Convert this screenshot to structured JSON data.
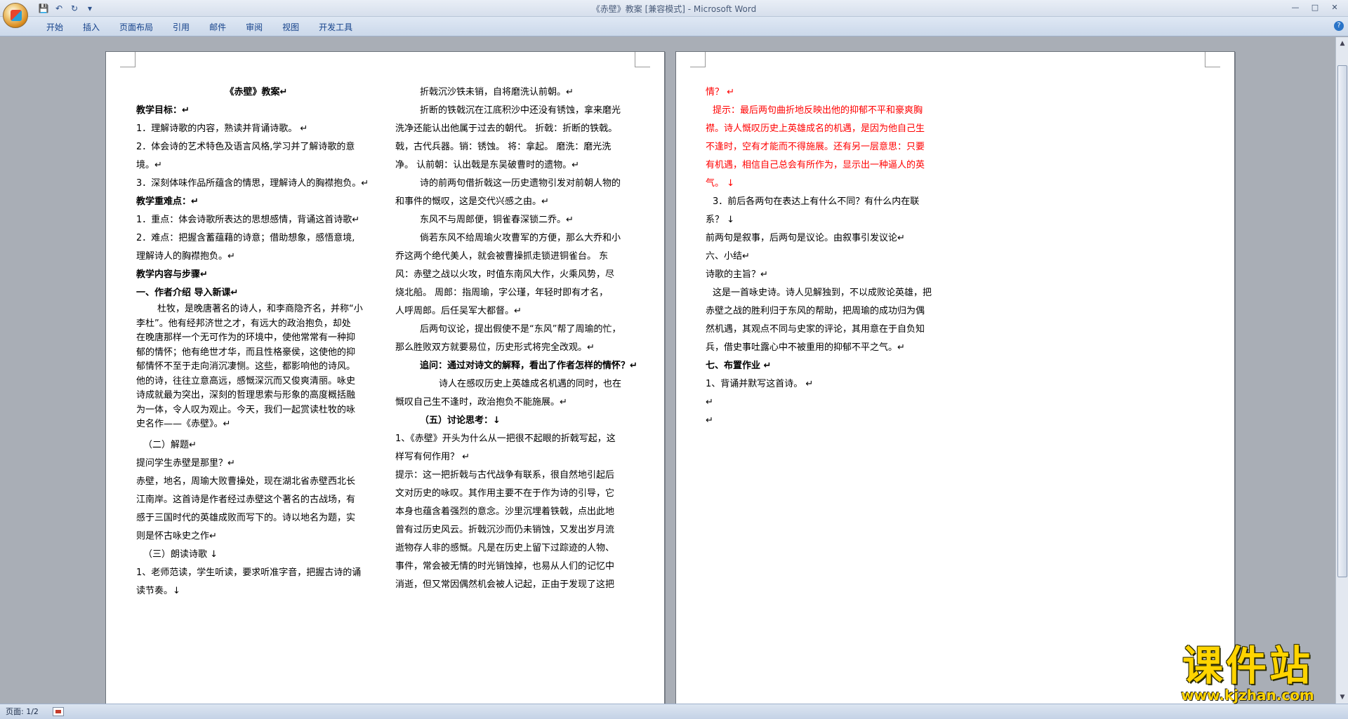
{
  "window": {
    "title": "《赤壁》教案 [兼容模式] - Microsoft Word",
    "qat": {
      "save": "💾",
      "undo": "↶",
      "redo": "↻",
      "more": "▾"
    },
    "controls": {
      "minimize": "—",
      "maximize": "□",
      "close": "✕"
    },
    "help": "?"
  },
  "ribbon": {
    "tabs": [
      "开始",
      "插入",
      "页面布局",
      "引用",
      "邮件",
      "审阅",
      "视图",
      "开发工具"
    ]
  },
  "page1": {
    "col1": [
      "《赤壁》教案↵",
      "教学目标：↵",
      "1．理解诗歌的内容，熟读并背诵诗歌。 ↵",
      "2．体会诗的艺术特色及语言风格,学习并了解诗歌的意",
      "境。↵",
      "3．深刻体味作品所蕴含的情思，理解诗人的胸襟抱负。↵",
      "教学重难点：↵",
      "1．重点：体会诗歌所表达的思想感情，背诵这首诗歌↵",
      "2．难点：把握含蓄蕴藉的诗意；借助想象，感悟意境,",
      "理解诗人的胸襟抱负。↵",
      "教学内容与步骤↵",
      "一、作者介绍 导入新课↵",
      "杜牧，是晚唐著名的诗人，和李商隐齐名，并称“小",
      "李杜”。他有经邦济世之才，有远大的政治抱负，却处",
      "在晚唐那样一个无可作为的环境中，使他常常有一种抑",
      "郁的情怀；他有绝世才华，而且性格豪侯，这使他的抑",
      "郁情怀不至于走向消沉凄恻。这些，都影响他的诗风。",
      "他的诗，往往立意高远，感慨深沉而又俊爽清丽。咏史",
      "诗成就最为突出，深刻的哲理思索与形象的高度概括融",
      "为一体，令人叹为观止。今天，我们一起赏读杜牧的咏",
      "史名作——《赤壁》。↵",
      "（二）解题↵",
      "提问学生赤壁是那里？↵",
      "赤壁，地名，周瑜大败曹操处，现在湖北省赤壁西北长",
      "江南岸。这首诗是作者经过赤壁这个著名的古战场，有",
      "感于三国时代的英雄成败而写下的。诗以地名为题，实",
      "则是怀古咏史之作↵",
      "（三）朗读诗歌 ↓",
      "1、老师范读，学生听读，要求听准字音，把握古诗的诵",
      "读节奏。↓"
    ],
    "col2": [
      "折戟沉沙铁未销，自将磨洗认前朝。↵",
      "折断的铁戟沉在江底积沙中还没有锈蚀，拿来磨光",
      "洗净还能认出他属于过去的朝代。 折戟：折断的铁戟。",
      "戟，古代兵器。销：锈蚀。 将：拿起。 磨洗：磨光洗",
      "净。 认前朝：认出戟是东吴破曹时的遗物。↵",
      "诗的前两句借折戟这一历史遗物引发对前朝人物的",
      "和事件的慨叹，这是交代兴感之由。↵",
      "东风不与周郎便，铜雀春深锁二乔。↵",
      "倘若东风不给周瑜火攻曹军的方便，那么大乔和小",
      "乔这两个绝代美人，就会被曹操抓走锁进铜雀台。 东",
      "风：赤壁之战以火攻，时值东南风大作，火乘风势，尽",
      "烧北船。 周郎：指周瑜，字公瑾，年轻时即有才名，",
      "人呼周郎。后任吴军大都督。↵",
      "后两句议论，提出假使不是“东风”帮了周瑜的忙，",
      "那么胜败双方就要易位，历史形式将完全改观。↵",
      "追问：通过对诗文的解释，看出了作者怎样的情怀？↵",
      "诗人在感叹历史上英雄成名机遇的同时，也在",
      "慨叹自己生不逢时，政治抱负不能施展。↵",
      "（五）讨论思考：↓",
      "1、《赤壁》开头为什么从一把很不起眼的折戟写起，这",
      "样写有何作用？ ↵",
      "提示：这一把折戟与古代战争有联系，很自然地引起后",
      "文对历史的咏叹。其作用主要不在于作为诗的引导，它",
      "本身也蕴含着强烈的意念。沙里沉埋着铁戟，点出此地",
      "曾有过历史风云。折戟沉沙而仍未销蚀，又发出岁月流",
      "逝物存人非的感慨。凡是在历史上留下过踪迹的人物、",
      "事件，常会被无情的时光销蚀掉，也易从人们的记忆中",
      "消逝，但又常因偶然机会被人记起，正由于发现了这把"
    ]
  },
  "page2": {
    "col1": [
      "情？ ↵",
      "提示：最后两句曲折地反映出他的抑郁不平和豪爽胸",
      "襟。诗人慨叹历史上英雄成名的机遇，是因为他自己生",
      "不逢时，空有才能而不得施展。还有另一层意思：只要",
      "有机遇，相信自己总会有所作为，显示出一种逼人的英",
      "气。 ↓",
      "3．前后各两句在表达上有什么不同？有什么内在联",
      "系？ ↓",
      "前两句是叙事，后两句是议论。由叙事引发议论↵",
      "六、小结↵",
      "诗歌的主旨？↵",
      "这是一首咏史诗。诗人见解独到，不以成败论英雄，把",
      "赤壁之战的胜利归于东风的帮助，把周瑜的成功归为偶",
      "然机遇，其观点不同与史家的评论，其用意在于自负知",
      "兵，借史事吐露心中不被重用的抑郁不平之气。↵",
      "七、布置作业 ↵",
      "1、背诵并默写这首诗。 ↵",
      "↵",
      "↵"
    ]
  },
  "statusbar": {
    "page_count": "页面: 1/2"
  },
  "watermark": {
    "title": "课件站",
    "url": "www.kjzhan.com"
  },
  "colors": {
    "accent_red": "#ff0000",
    "ribbon_text": "#15428b",
    "watermark": "#ffd400"
  }
}
